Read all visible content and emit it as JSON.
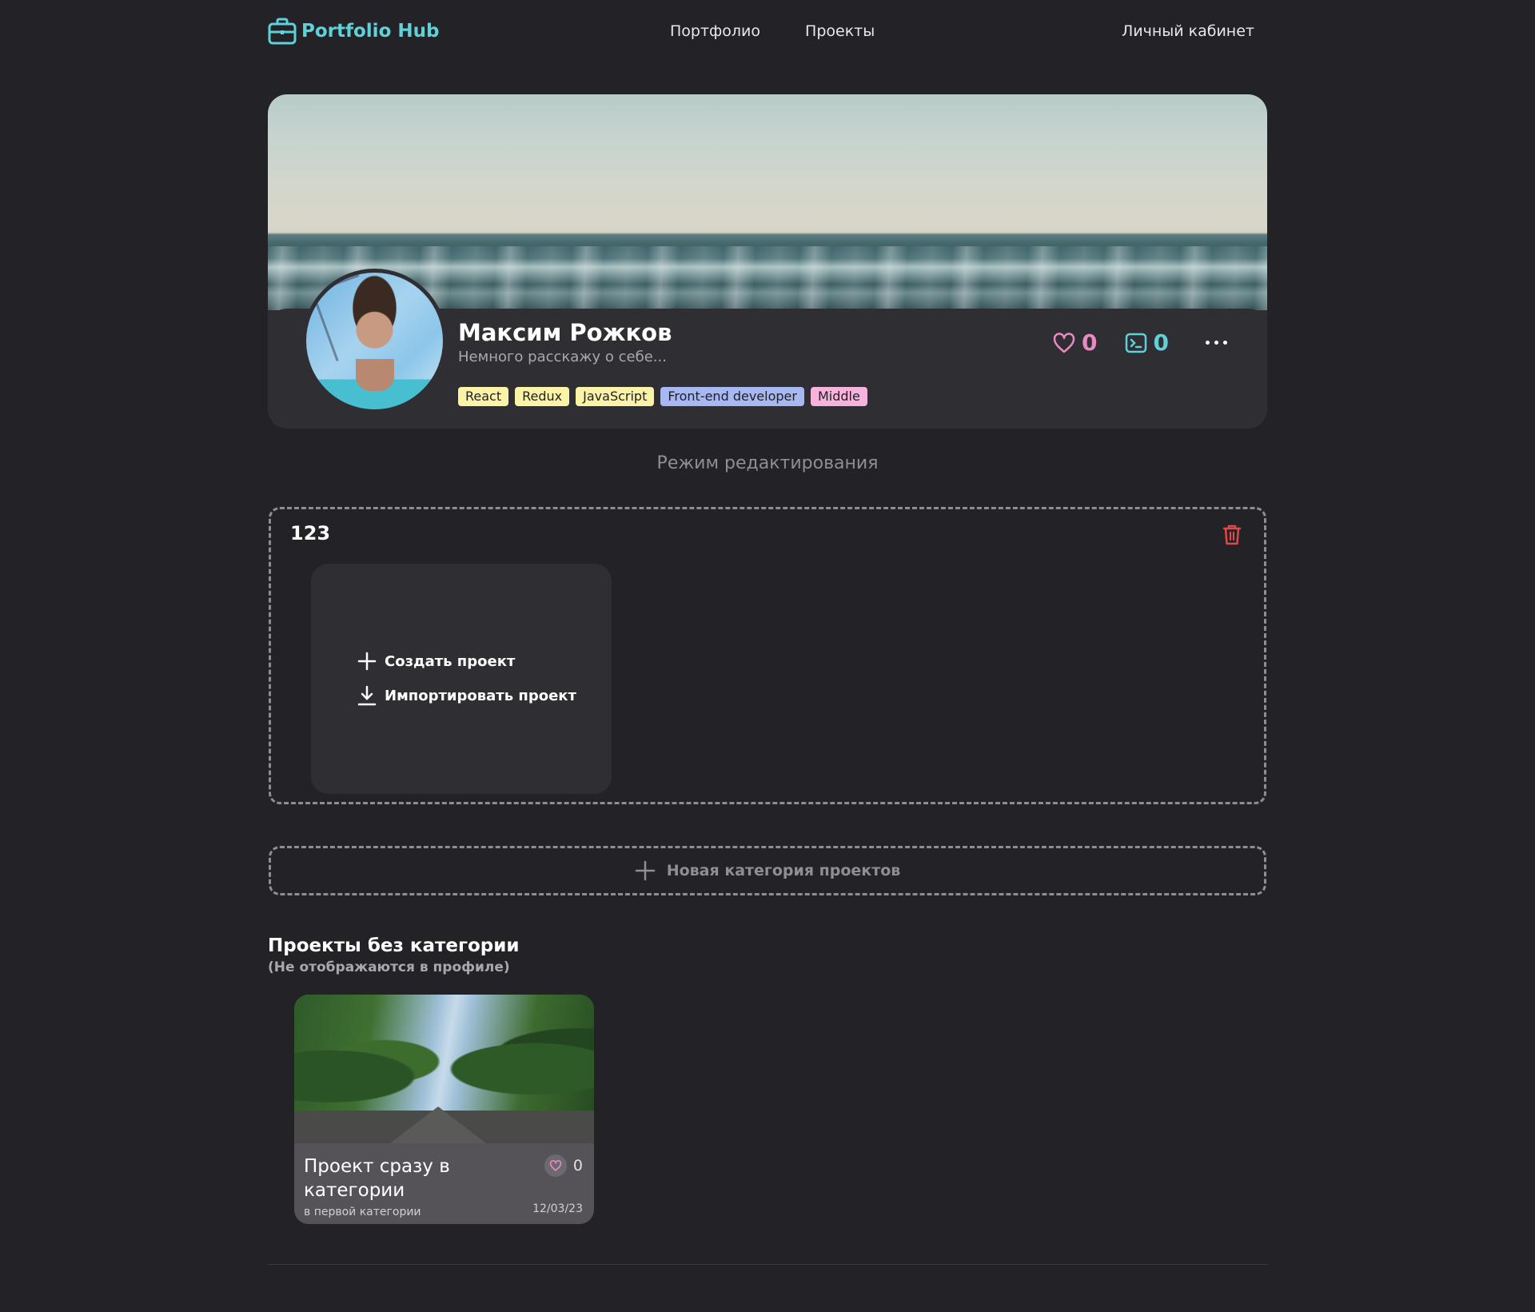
{
  "header": {
    "logo_text": "Portfolio Hub",
    "nav": [
      {
        "label": "Портфолио"
      },
      {
        "label": "Проекты"
      }
    ],
    "account_label": "Личный кабинет"
  },
  "profile": {
    "name": "Максим Рожков",
    "bio": "Немного расскажу о себе...",
    "tags": [
      {
        "label": "React",
        "color": "#fbf3a6"
      },
      {
        "label": "Redux",
        "color": "#fbf3a6"
      },
      {
        "label": "JavaScript",
        "color": "#fbf3a6"
      },
      {
        "label": "Front-end developer",
        "color": "#a7b8f2"
      },
      {
        "label": "Middle",
        "color": "#f6b3dc"
      }
    ],
    "likes_count": "0",
    "projects_count": "0"
  },
  "edit_mode_label": "Режим редактирования",
  "category": {
    "title": "123",
    "create_label": "Создать проект",
    "import_label": "Импортировать проект"
  },
  "new_category_label": "Новая категория проектов",
  "uncategorized": {
    "title": "Проекты без категории",
    "subtitle": "(Не отображаются в профиле)",
    "projects": [
      {
        "title": "Проект сразу в категории",
        "category": "в первой категории",
        "likes": "0",
        "date": "12/03/23"
      }
    ]
  },
  "colors": {
    "accent_teal": "#5fd1d8",
    "accent_pink": "#e889c1",
    "danger_red": "#e04848",
    "background": "#222227"
  }
}
